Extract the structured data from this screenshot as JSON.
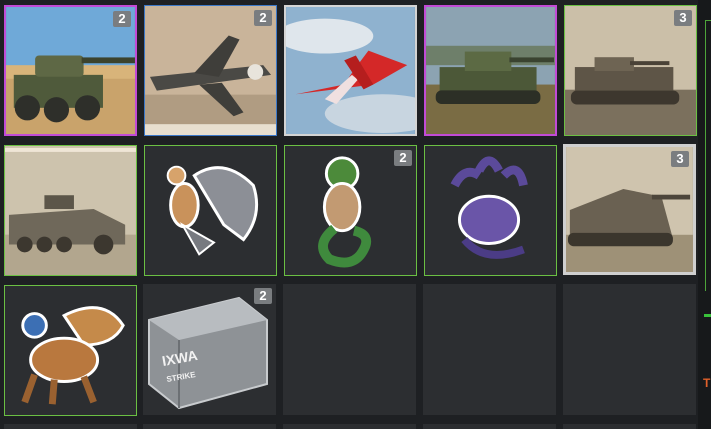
{
  "inventory": {
    "items": [
      {
        "name": "light-tank-desert",
        "badge": "2",
        "rarity": "purple"
      },
      {
        "name": "fighter-plane-sepia",
        "badge": "2",
        "rarity": "blue"
      },
      {
        "name": "red-aerobatic-plane",
        "badge": "",
        "rarity": "white"
      },
      {
        "name": "main-battle-tank",
        "badge": "",
        "rarity": "purple"
      },
      {
        "name": "sepia-tank",
        "badge": "3",
        "rarity": "green"
      },
      {
        "name": "halftrack-sepia",
        "badge": "",
        "rarity": "green"
      },
      {
        "name": "harpy-decal",
        "badge": "",
        "rarity": "green"
      },
      {
        "name": "medusa-decal",
        "badge": "2",
        "rarity": "green"
      },
      {
        "name": "hydra-decal",
        "badge": "",
        "rarity": "green"
      },
      {
        "name": "tank-destroyer-sepia",
        "badge": "3",
        "rarity": "white"
      },
      {
        "name": "griffin-decal",
        "badge": "",
        "rarity": "green"
      },
      {
        "name": "ammo-crate",
        "badge": "2",
        "rarity": "none",
        "crate_text": "IXWA",
        "crate_subtext": "STRIKE"
      },
      {
        "name": "empty-slot",
        "badge": "",
        "rarity": "none"
      },
      {
        "name": "empty-slot",
        "badge": "",
        "rarity": "none"
      },
      {
        "name": "empty-slot",
        "badge": "",
        "rarity": "none"
      }
    ]
  },
  "side_panel": {
    "text1": " ",
    "text2": "T"
  }
}
